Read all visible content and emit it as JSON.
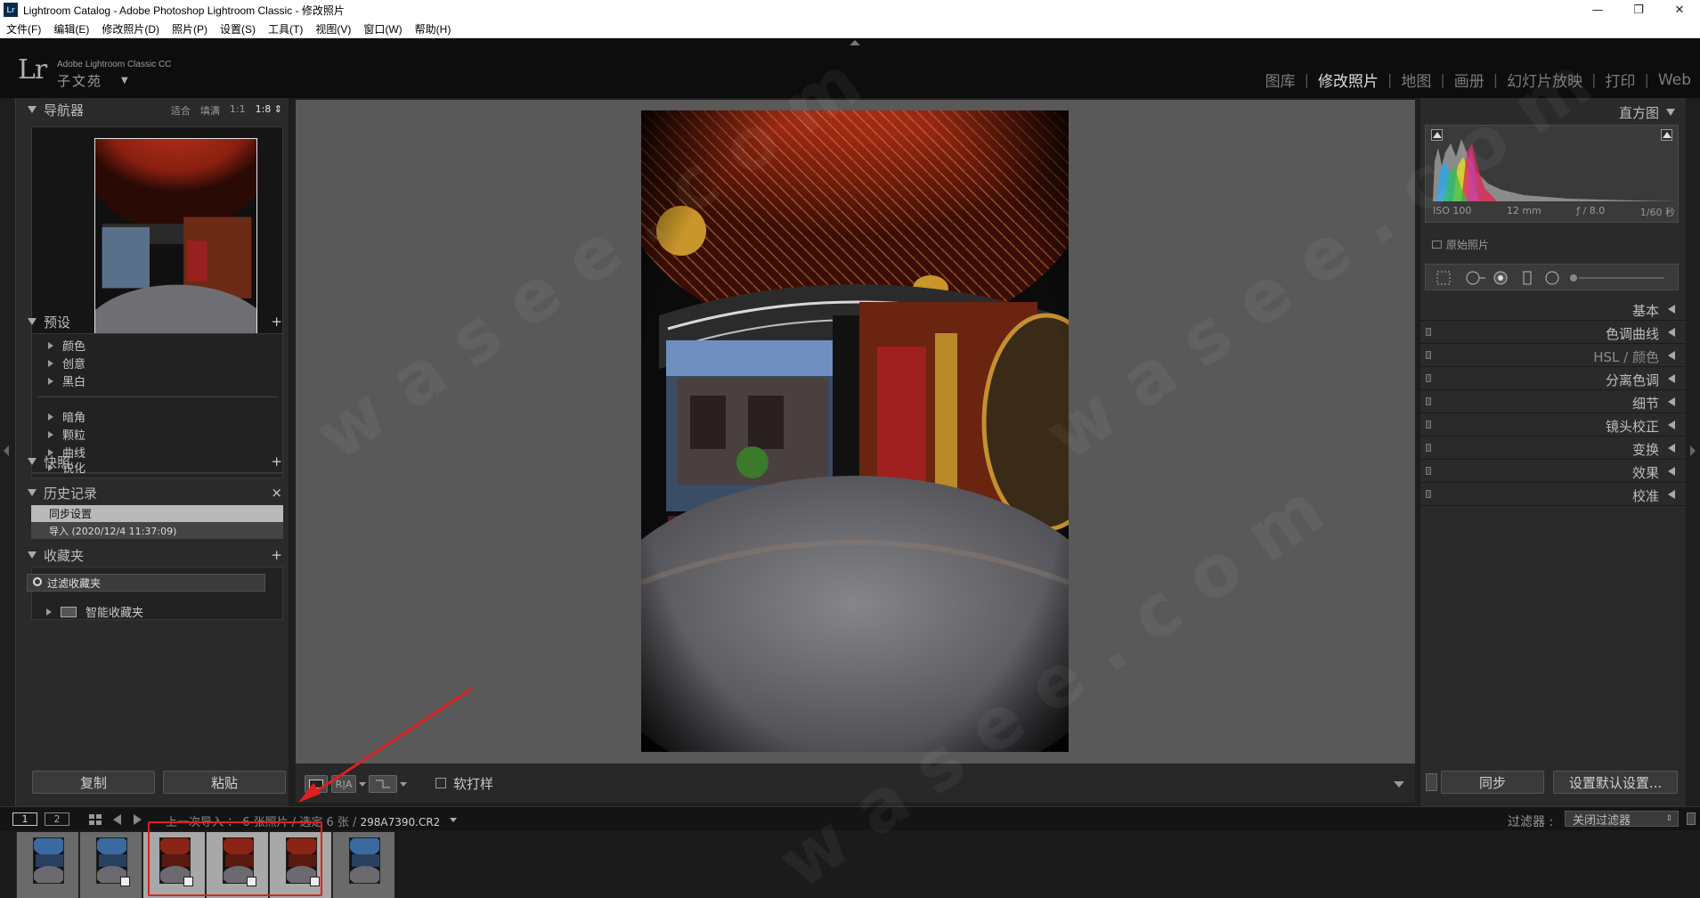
{
  "window": {
    "title": "Lightroom Catalog - Adobe Photoshop Lightroom Classic - 修改照片",
    "app_icon": "Lr",
    "minimize": "—",
    "restore": "❐",
    "close": "✕"
  },
  "menu": [
    {
      "label": "文件(F)"
    },
    {
      "label": "编辑(E)"
    },
    {
      "label": "修改照片(D)"
    },
    {
      "label": "照片(P)"
    },
    {
      "label": "设置(S)"
    },
    {
      "label": "工具(T)"
    },
    {
      "label": "视图(V)"
    },
    {
      "label": "窗口(W)"
    },
    {
      "label": "帮助(H)"
    }
  ],
  "identity": {
    "logo": "Lr",
    "product": "Adobe Lightroom Classic CC",
    "user": "子文苑"
  },
  "modules": [
    "图库",
    "修改照片",
    "地图",
    "画册",
    "幻灯片放映",
    "打印",
    "Web"
  ],
  "active_module": "修改照片",
  "left": {
    "navigator": {
      "title": "导航器",
      "zoom_fit": "适合",
      "zoom_fill": "填满",
      "zoom_1_1": "1:1",
      "zoom_custom": "1:8"
    },
    "presets": {
      "title": "预设",
      "plus": "+",
      "items_a": [
        "颜色",
        "创意",
        "黑白"
      ],
      "items_b": [
        "暗角",
        "颗粒",
        "曲线",
        "锐化"
      ]
    },
    "snapshots": {
      "title": "快照",
      "plus": "+"
    },
    "history": {
      "title": "历史记录",
      "close": "×",
      "rows": [
        {
          "label": "同步设置"
        },
        {
          "label": "导入 (2020/12/4 11:37:09)"
        }
      ]
    },
    "collections": {
      "title": "收藏夹",
      "plus": "+",
      "filter_placeholder": "过滤收藏夹",
      "smart": "智能收藏夹"
    },
    "copy_button": "复制",
    "paste_button": "粘贴"
  },
  "toolbar": {
    "compare_label": "R|A",
    "softproof_label": "软打样"
  },
  "right": {
    "histogram": {
      "title": "直方图",
      "iso": "ISO 100",
      "focal": "12 mm",
      "aperture": "ƒ / 8.0",
      "shutter": "1/60 秒",
      "original": "原始照片"
    },
    "sections": [
      {
        "label": "基本",
        "dim": false,
        "switch": false
      },
      {
        "label": "色调曲线",
        "dim": false,
        "switch": true
      },
      {
        "label": "HSL / 颜色",
        "dim": true,
        "switch": true
      },
      {
        "label": "分离色调",
        "dim": false,
        "switch": true
      },
      {
        "label": "细节",
        "dim": false,
        "switch": true
      },
      {
        "label": "镜头校正",
        "dim": false,
        "switch": true
      },
      {
        "label": "变换",
        "dim": false,
        "switch": true
      },
      {
        "label": "效果",
        "dim": false,
        "switch": true
      },
      {
        "label": "校准",
        "dim": false,
        "switch": true
      }
    ],
    "sync_button": "同步",
    "reset_button": "设置默认设置..."
  },
  "filmstrip": {
    "screen1": "1",
    "screen2": "2",
    "source_text": "上一次导入 ： 6 张照片 / 选定 6 张 / ",
    "filename": "298A7390.CR2",
    "filter_label": "过滤器 :",
    "filter_value": "关闭过滤器",
    "thumbs": [
      {
        "style": "blue",
        "selected": false
      },
      {
        "style": "blue",
        "selected": false
      },
      {
        "style": "red",
        "selected": true
      },
      {
        "style": "red",
        "selected": true
      },
      {
        "style": "red",
        "selected": true
      },
      {
        "style": "blue",
        "selected": false
      }
    ]
  },
  "colors": {
    "annotation": "#e02020",
    "canvas_bg": "#595959",
    "panel_bg": "#2a2a2a"
  }
}
